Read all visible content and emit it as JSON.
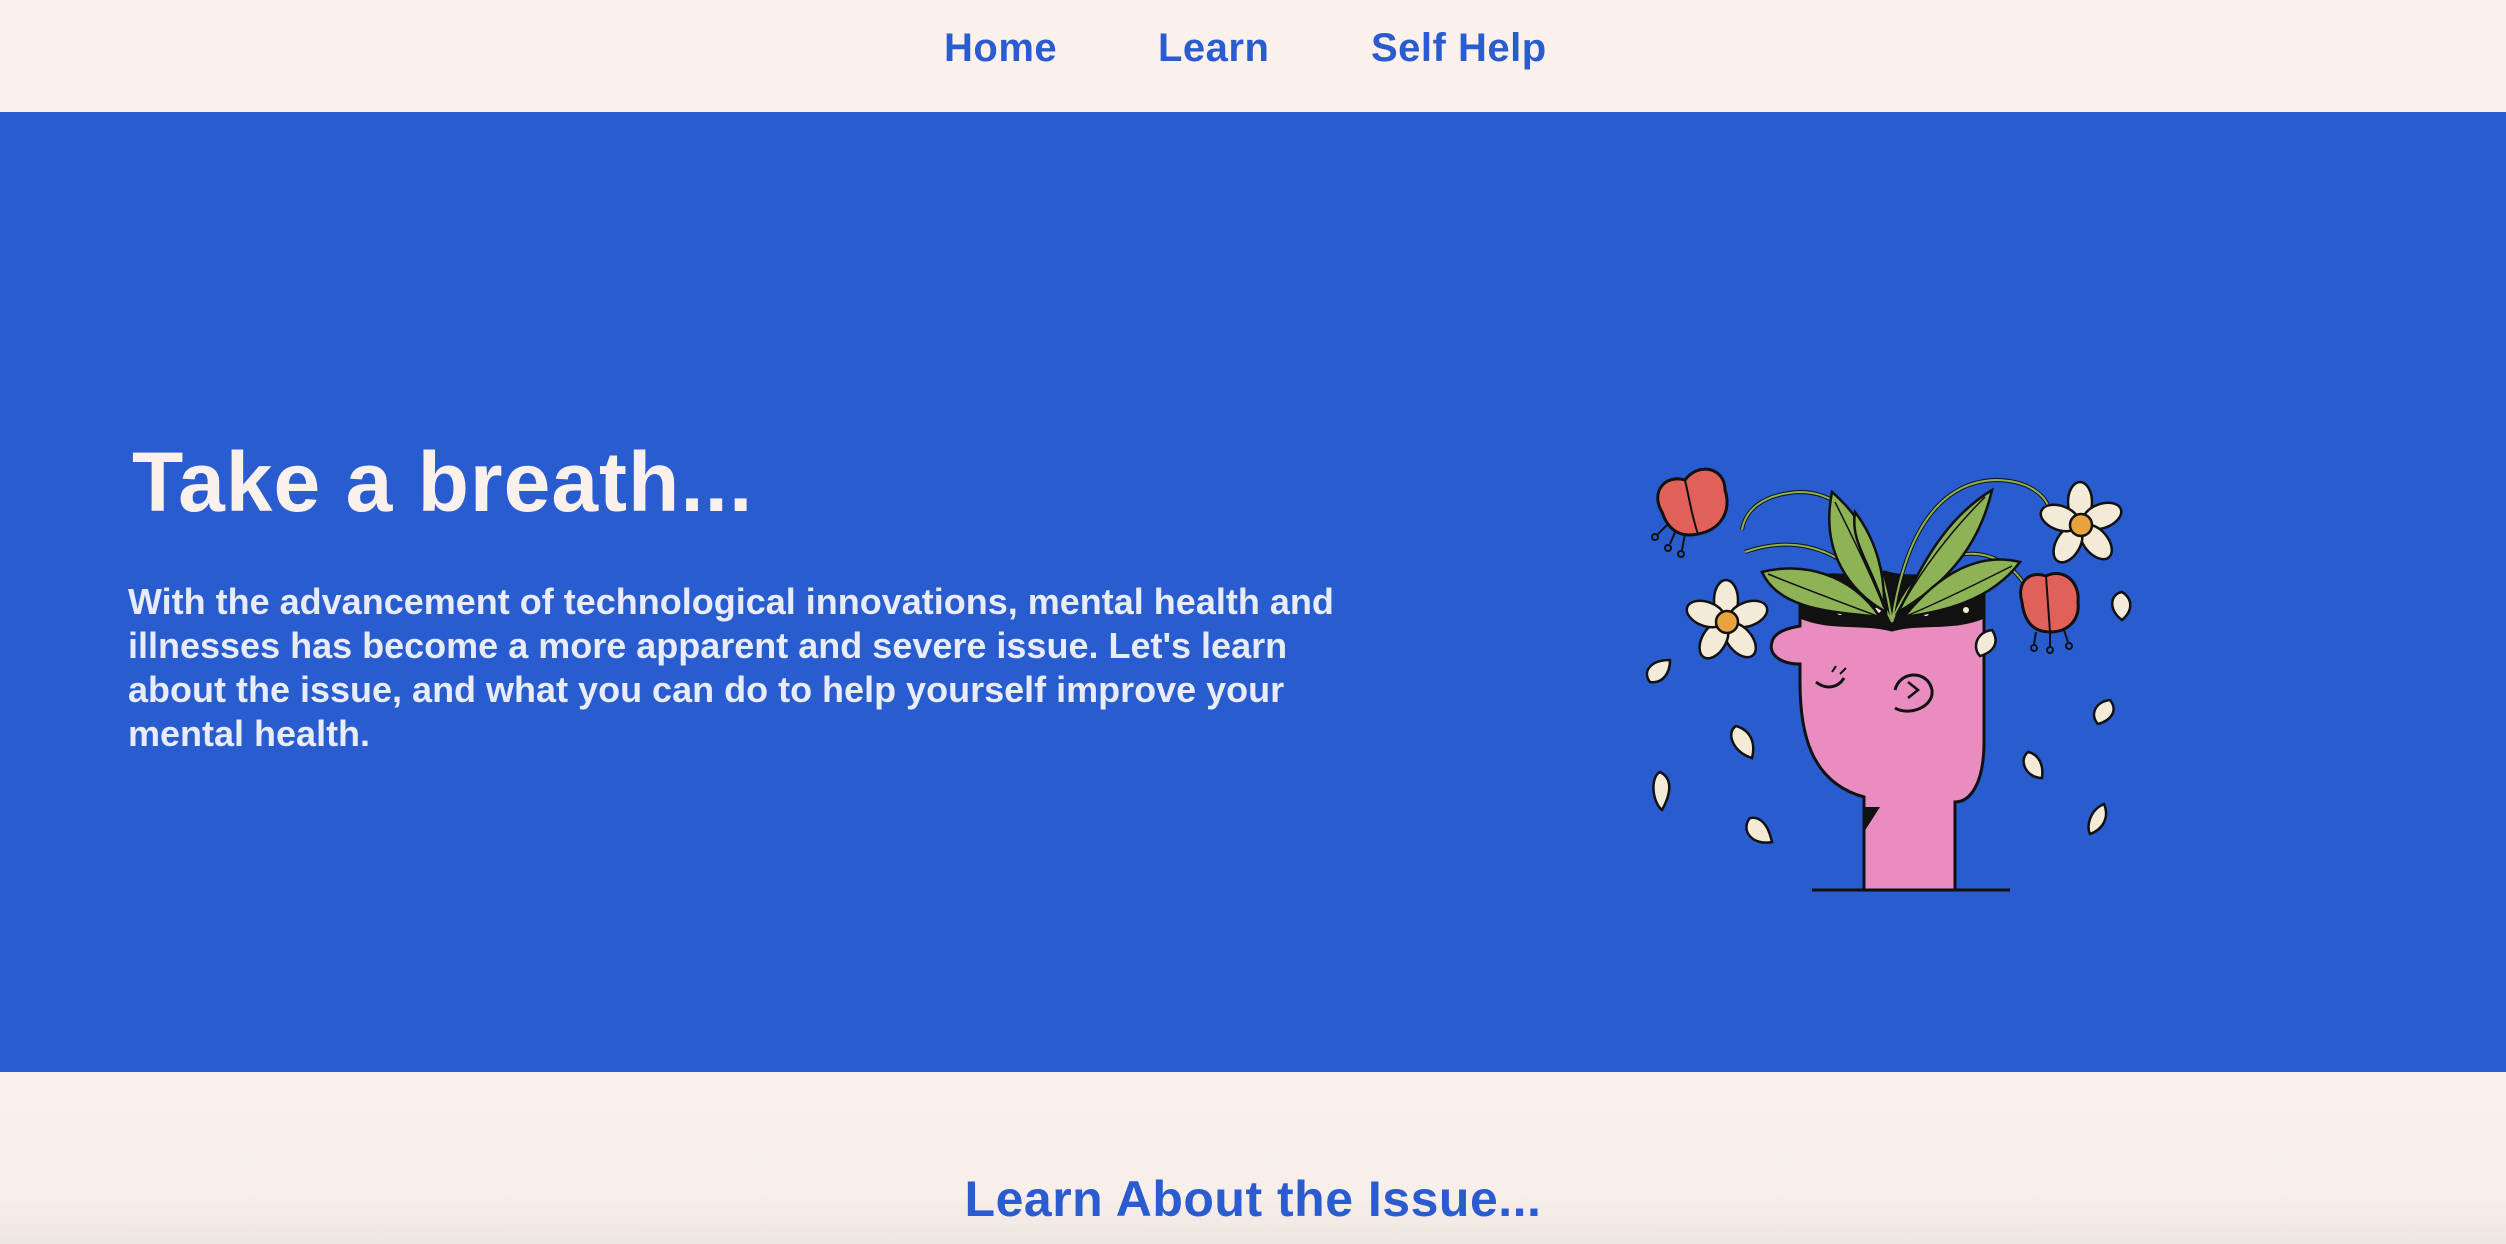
{
  "nav": {
    "items": [
      {
        "label": "Home"
      },
      {
        "label": "Learn"
      },
      {
        "label": "Self Help"
      }
    ]
  },
  "hero": {
    "title": "Take a breath...",
    "text": "With the advancement of technological innovations, mental health and illnesses has become a more apparent and severe issue. Let's learn about the issue, and what you can do to help yourself improve your mental health.",
    "illustration": "head-with-flowers-illustration"
  },
  "section": {
    "title": "Learn About the Issue..."
  },
  "colors": {
    "brand_blue": "#295CCF",
    "cream": "#FAF1EC",
    "link_blue": "#2A5BCF",
    "face_pink": "#E98DC0",
    "flower_red": "#E0605A",
    "leaf_green": "#8DB356",
    "petal_cream": "#F4EAD8"
  }
}
